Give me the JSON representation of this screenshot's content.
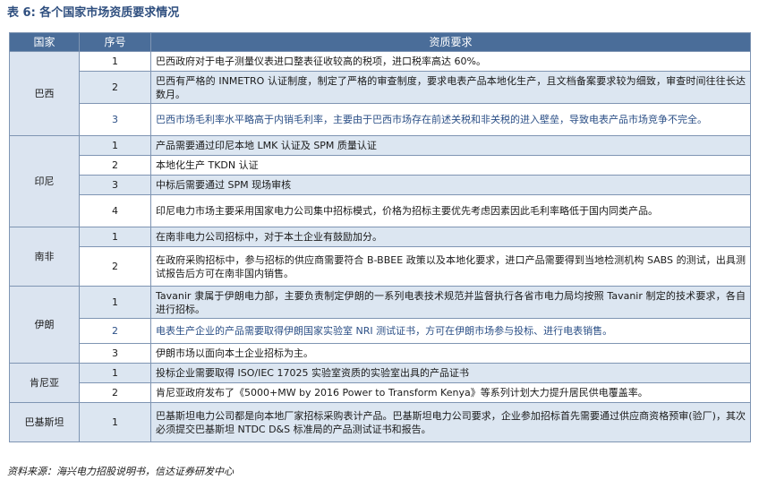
{
  "title": "表 6: 各个国家市场资质要求情况",
  "headers": {
    "country": "国家",
    "seq": "序号",
    "requirement": "资质要求"
  },
  "countries": [
    {
      "name": "巴西",
      "rows": [
        {
          "no": "1",
          "text": "巴西政府对于电子测量仪表进口整表征收较高的税项，进口税率高达 60%。"
        },
        {
          "no": "2",
          "text": "巴西有严格的 INMETRO 认证制度，制定了严格的审查制度，要求电表产品本地化生产，且文档备案要求较为细致，审查时间往往长达数月。"
        },
        {
          "no": "3",
          "text": "巴西市场毛利率水平略高于内销毛利率，主要由于巴西市场存在前述关税和非关税的进入壁垒，导致电表产品市场竞争不完全。"
        }
      ]
    },
    {
      "name": "印尼",
      "rows": [
        {
          "no": "1",
          "text": "产品需要通过印尼本地 LMK 认证及 SPM 质量认证"
        },
        {
          "no": "2",
          "text": "本地化生产 TKDN 认证"
        },
        {
          "no": "3",
          "text": "中标后需要通过 SPM 现场审核"
        },
        {
          "no": "4",
          "text": "印尼电力市场主要采用国家电力公司集中招标模式，价格为招标主要优先考虑因素因此毛利率略低于国内同类产品。"
        }
      ]
    },
    {
      "name": "南非",
      "rows": [
        {
          "no": "1",
          "text": "在南非电力公司招标中，对于本土企业有鼓励加分。"
        },
        {
          "no": "2",
          "text": "在政府采购招标中，参与招标的供应商需要符合 B-BBEE 政策以及本地化要求，进口产品需要得到当地检测机构 SABS 的测试，出具测试报告后方可在南非国内销售。"
        }
      ]
    },
    {
      "name": "伊朗",
      "rows": [
        {
          "no": "1",
          "text": "Tavanir 隶属于伊朗电力部，主要负责制定伊朗的一系列电表技术规范并监督执行各省市电力局均按照 Tavanir 制定的技术要求，各自进行招标。"
        },
        {
          "no": "2",
          "text": "电表生产企业的产品需要取得伊朗国家实验室 NRI 测试证书，方可在伊朗市场参与投标、进行电表销售。"
        },
        {
          "no": "3",
          "text": "伊朗市场以面向本土企业招标为主。"
        }
      ]
    },
    {
      "name": "肯尼亚",
      "rows": [
        {
          "no": "1",
          "text": "投标企业需要取得 ISO/IEC 17025 实验室资质的实验室出具的产品证书"
        },
        {
          "no": "2",
          "text": "肯尼亚政府发布了《5000+MW by 2016 Power to Transform Kenya》等系列计划大力提升居民供电覆盖率。"
        }
      ]
    },
    {
      "name": "巴基斯坦",
      "rows": [
        {
          "no": "1",
          "text": "巴基斯坦电力公司都是向本地厂家招标采购表计产品。巴基斯坦电力公司要求，企业参加招标首先需要通过供应商资格预审(验厂)，其次必须提交巴基斯坦 NTDC D&S 标准局的产品测试证书和报告。"
        }
      ]
    }
  ],
  "source": "资料来源：海兴电力招股说明书，信达证券研发中心"
}
